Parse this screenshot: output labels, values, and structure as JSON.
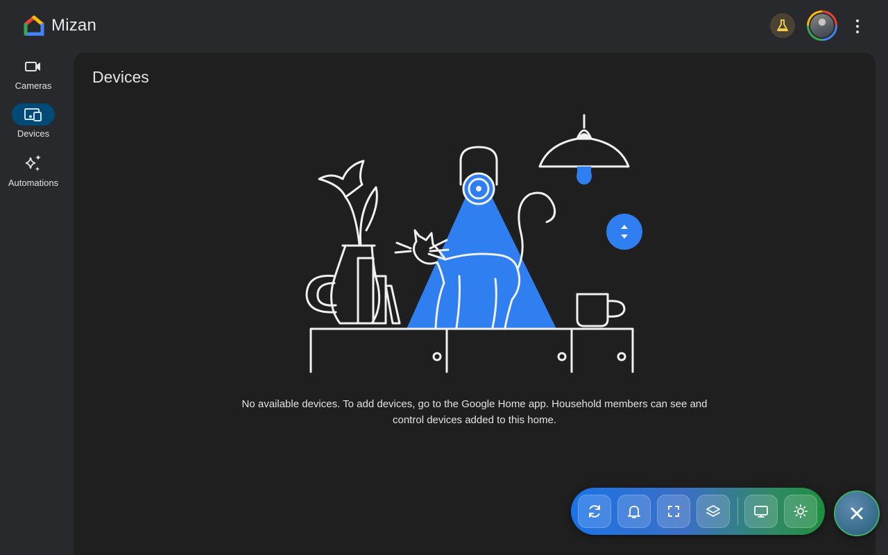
{
  "app": {
    "name": "Mizan"
  },
  "header": {
    "labs_icon": "flask-icon",
    "avatar": "user-avatar",
    "menu_icon": "more-vert-icon"
  },
  "sidenav": {
    "items": [
      {
        "label": "Cameras",
        "icon": "videocam-icon",
        "active": false
      },
      {
        "label": "Devices",
        "icon": "devices-icon",
        "active": true
      },
      {
        "label": "Automations",
        "icon": "sparkle-icon",
        "active": false
      }
    ]
  },
  "main": {
    "title": "Devices",
    "empty_message": "No available devices. To add devices, go to the Google Home app. Household members can see and control devices added to this home."
  },
  "toolbar": {
    "buttons": [
      "refresh-icon",
      "bell-icon",
      "fullscreen-icon",
      "layers-icon",
      "monitor-icon",
      "brightness-icon"
    ],
    "close_icon": "close-icon"
  },
  "colors": {
    "background": "#28292c",
    "panel": "#1f1f1f",
    "accent_blue": "#1a73e8",
    "active_nav": "#004a77"
  }
}
